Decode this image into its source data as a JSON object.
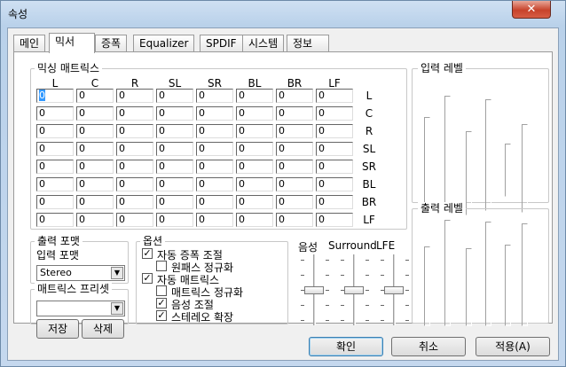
{
  "window": {
    "title": "속성",
    "close_label": "✕"
  },
  "tabs": [
    "메인",
    "믹서",
    "증폭",
    "Equalizer",
    "SPDIF",
    "시스템",
    "정보"
  ],
  "active_tab": "믹서",
  "mixing_matrix": {
    "legend": "믹싱 매트릭스",
    "columns": [
      "L",
      "C",
      "R",
      "SL",
      "SR",
      "BL",
      "BR",
      "LF"
    ],
    "rows": [
      "L",
      "C",
      "R",
      "SL",
      "SR",
      "BL",
      "BR",
      "LF"
    ],
    "values": [
      [
        "0",
        "0",
        "0",
        "0",
        "0",
        "0",
        "0",
        "0"
      ],
      [
        "0",
        "0",
        "0",
        "0",
        "0",
        "0",
        "0",
        "0"
      ],
      [
        "0",
        "0",
        "0",
        "0",
        "0",
        "0",
        "0",
        "0"
      ],
      [
        "0",
        "0",
        "0",
        "0",
        "0",
        "0",
        "0",
        "0"
      ],
      [
        "0",
        "0",
        "0",
        "0",
        "0",
        "0",
        "0",
        "0"
      ],
      [
        "0",
        "0",
        "0",
        "0",
        "0",
        "0",
        "0",
        "0"
      ],
      [
        "0",
        "0",
        "0",
        "0",
        "0",
        "0",
        "0",
        "0"
      ],
      [
        "0",
        "0",
        "0",
        "0",
        "0",
        "0",
        "0",
        "0"
      ]
    ]
  },
  "input_level": {
    "legend": "입력 레벨"
  },
  "output_level": {
    "legend": "출력 레벨"
  },
  "output_format": {
    "legend": "출력 포맷",
    "input_format_label": "입력 포맷",
    "input_format_value": "Stereo"
  },
  "matrix_preset": {
    "legend": "매트릭스 프리셋",
    "value": "",
    "save_label": "저장",
    "delete_label": "삭제"
  },
  "options": {
    "legend": "옵션",
    "items": [
      {
        "label": "자동 증폭 조절",
        "checked": true
      },
      {
        "label": "원패스 정규화",
        "checked": false
      },
      {
        "label": "자동 매트릭스",
        "checked": true
      },
      {
        "label": "매트릭스 정규화",
        "checked": false
      },
      {
        "label": "음성 조절",
        "checked": true
      },
      {
        "label": "스테레오 확장",
        "checked": true
      }
    ]
  },
  "sliders": {
    "labels": [
      "음성",
      "Surround",
      "LFE"
    ]
  },
  "buttons": {
    "ok": "확인",
    "cancel": "취소",
    "apply": "적용(A)"
  }
}
